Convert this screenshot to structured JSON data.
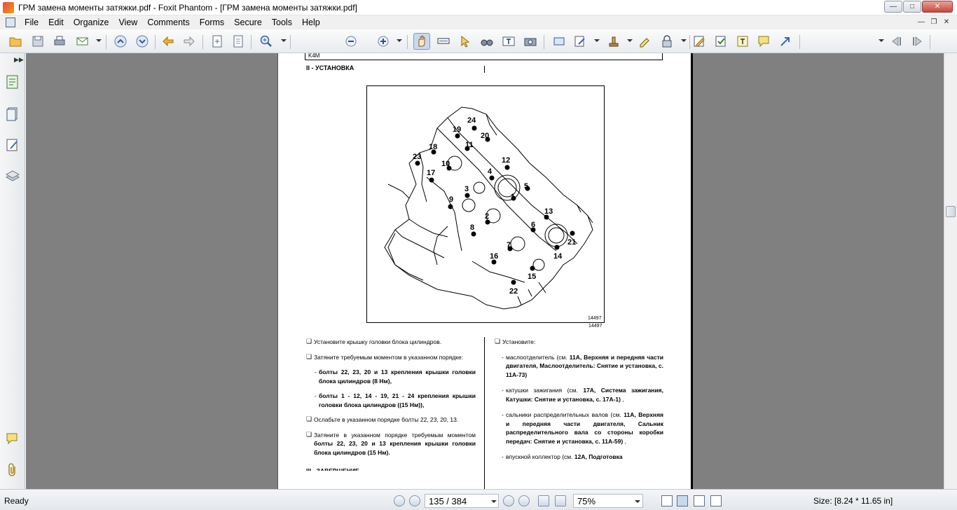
{
  "window": {
    "title": "ГРМ замена моменты затяжки.pdf - Foxit Phantom - [ГРМ замена моменты затяжки.pdf]"
  },
  "menu": [
    "File",
    "Edit",
    "Organize",
    "View",
    "Comments",
    "Forms",
    "Secure",
    "Tools",
    "Help"
  ],
  "toolbar": {
    "find_placeholder": "Find"
  },
  "document": {
    "header_box_label": "K4M",
    "section_heading": "II - УСТАНОВКА",
    "figure_number": "14497",
    "figure_labels": [
      "24",
      "19",
      "20",
      "18",
      "11",
      "23",
      "10",
      "12",
      "17",
      "4",
      "3",
      "5",
      "1",
      "9",
      "13",
      "2",
      "6",
      "8",
      "21",
      "7",
      "14",
      "16",
      "15",
      "22"
    ],
    "left_col": {
      "p1": "Установите крышку головки блока цилиндров.",
      "p2": "Затяните требуемым моментом в указанном порядке:",
      "s1": "болты 22, 23, 20 и 13 крепления крышки головки блока цилиндров (8 Нм),",
      "s2": "болты 1 - 12, 14 - 19, 21 - 24 крепления крышки головки блока цилиндров ((15 Нм)),",
      "p3": "Ослабьте в указанном порядке болты 22, 23, 20, 13.",
      "p4_pre": "Затяните в указанном порядке требуемым моментом",
      "p4_bold": "болты 22, 23, 20 и 13 крепления крышки головки блока цилиндров (15 Нм).",
      "p5_partial": "III - ЗАВЕРШЕНИЕ"
    },
    "right_col": {
      "intro": "Установите:",
      "r1_pre": "маслоотделитель (см.",
      "r1_bold": "11A, Верхняя и передняя части двигателя, Маслоотделитель: Снятие и установка, с. 11A-73)",
      "r2_pre": "катушки зажигания (см.",
      "r2_bold": "17A, Система зажигания, Катушки: Снятие и установка, с. 17A-1)",
      "r2_post": ",",
      "r3_pre": "сальники распределительных валов (см.",
      "r3_bold": "11A, Верхняя и передняя части двигателя, Сальник распределительного вала со стороны коробки передач: Снятие и установка, с. 11A-59)",
      "r3_post": ",",
      "r4_pre": "впускной коллектор (см.",
      "r4_bold": "12A, Подготовка"
    }
  },
  "status": {
    "ready": "Ready",
    "page": "135 / 384",
    "zoom": "75%",
    "size": "Size: [8.24 * 11.65 in]"
  }
}
